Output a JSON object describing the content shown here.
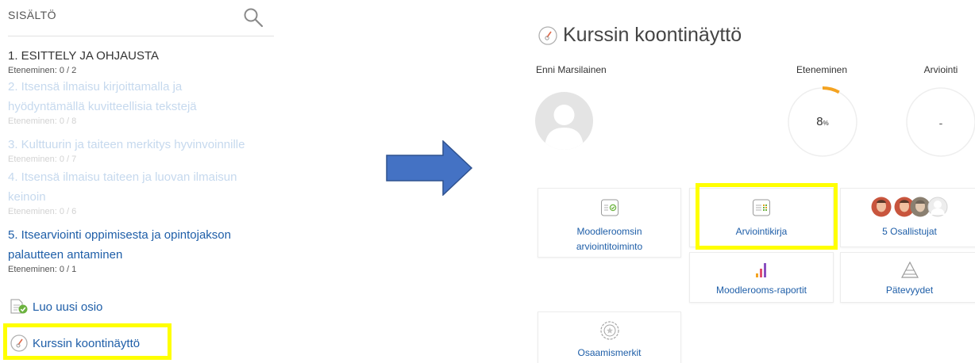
{
  "sidebar": {
    "title": "SISÄLTÖ",
    "sections": [
      {
        "title_lines": [
          "1. ESITTELY JA OHJAUSTA"
        ],
        "progress": "Eteneminen: 0 / 2"
      },
      {
        "title_lines": [
          "2. Itsensä ilmaisu kirjoittamalla ja",
          "hyödyntämällä kuvitteellisia tekstejä"
        ],
        "progress": "Eteneminen: 0 / 8"
      },
      {
        "title_lines": [
          "3. Kulttuurin ja taiteen merkitys hyvinvoinnille"
        ],
        "progress": "Eteneminen: 0 / 7"
      },
      {
        "title_lines": [
          "4. Itsensä ilmaisu taiteen ja luovan ilmaisun",
          "keinoin"
        ],
        "progress": "Eteneminen: 0 / 6"
      },
      {
        "title_lines": [
          "5. Itsearviointi oppimisesta ja opintojakson",
          "palautteen antaminen"
        ],
        "progress": "Eteneminen: 0 / 1"
      }
    ],
    "new_section_label": "Luo uusi osio",
    "dashboard_link_label": "Kurssin koontinäyttö"
  },
  "dashboard": {
    "title": "Kurssin koontinäyttö",
    "user_name": "Enni Marsilainen",
    "progress_label": "Eteneminen",
    "progress_value": "8",
    "progress_unit": "%",
    "progress_fraction": 0.08,
    "grade_label": "Arviointi",
    "grade_value": "-",
    "tiles": {
      "moodlerooms_grading": [
        "Moodleroomsin",
        "arviointitoiminto"
      ],
      "gradebook": "Arviointikirja",
      "participants": "5 Osallistujat",
      "reports": "Moodlerooms-raportit",
      "competencies": "Pätevyydet",
      "badges": "Osaamismerkit"
    }
  },
  "colors": {
    "link": "#1e5ea8",
    "highlight": "#ffff00",
    "arrow": "#4472c4",
    "progress": "#f4a321"
  }
}
